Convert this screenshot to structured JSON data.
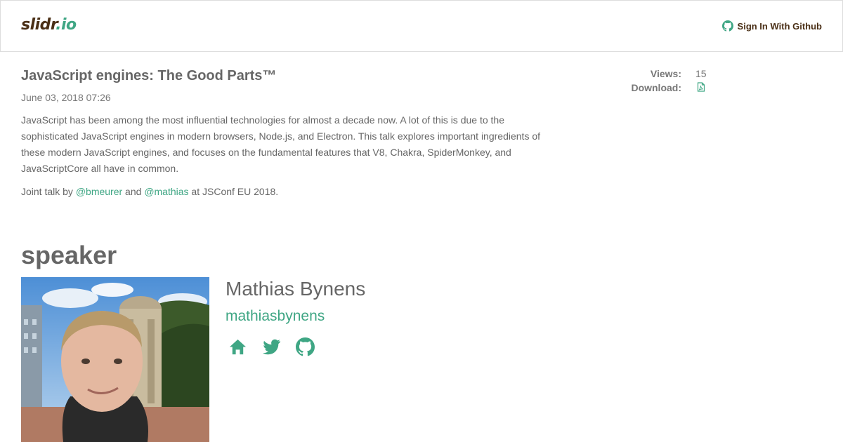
{
  "header": {
    "logo_main": "slidr",
    "logo_tld": ".io",
    "signin_label": "Sign In With Github",
    "signin_icon": "github-icon"
  },
  "talk": {
    "title": "JavaScript engines: The Good Parts™",
    "date": "June 03, 2018 07:26",
    "description": "JavaScript has been among the most influential technologies for almost a decade now. A lot of this is due to the sophisticated JavaScript engines in modern browsers, Node.js, and Electron. This talk explores important ingredients of these modern JavaScript engines, and focuses on the fundamental features that V8, Chakra, SpiderMonkey, and JavaScriptCore all have in common.",
    "joint_prefix": "Joint talk by ",
    "joint_author1": "@bmeurer",
    "joint_and": " and ",
    "joint_author2": "@mathias",
    "joint_suffix": " at JSConf EU 2018."
  },
  "stats": {
    "views_label": "Views:",
    "views_value": "15",
    "download_label": "Download:",
    "download_icon": "pdf-file-icon"
  },
  "speaker": {
    "heading": "speaker",
    "name": "Mathias Bynens",
    "handle": "mathiasbynens",
    "links": [
      "home-icon",
      "twitter-icon",
      "github-icon"
    ]
  },
  "colors": {
    "accent": "#3fa684",
    "brand": "#4a2f16",
    "text": "#666666",
    "border": "#dddddd"
  }
}
